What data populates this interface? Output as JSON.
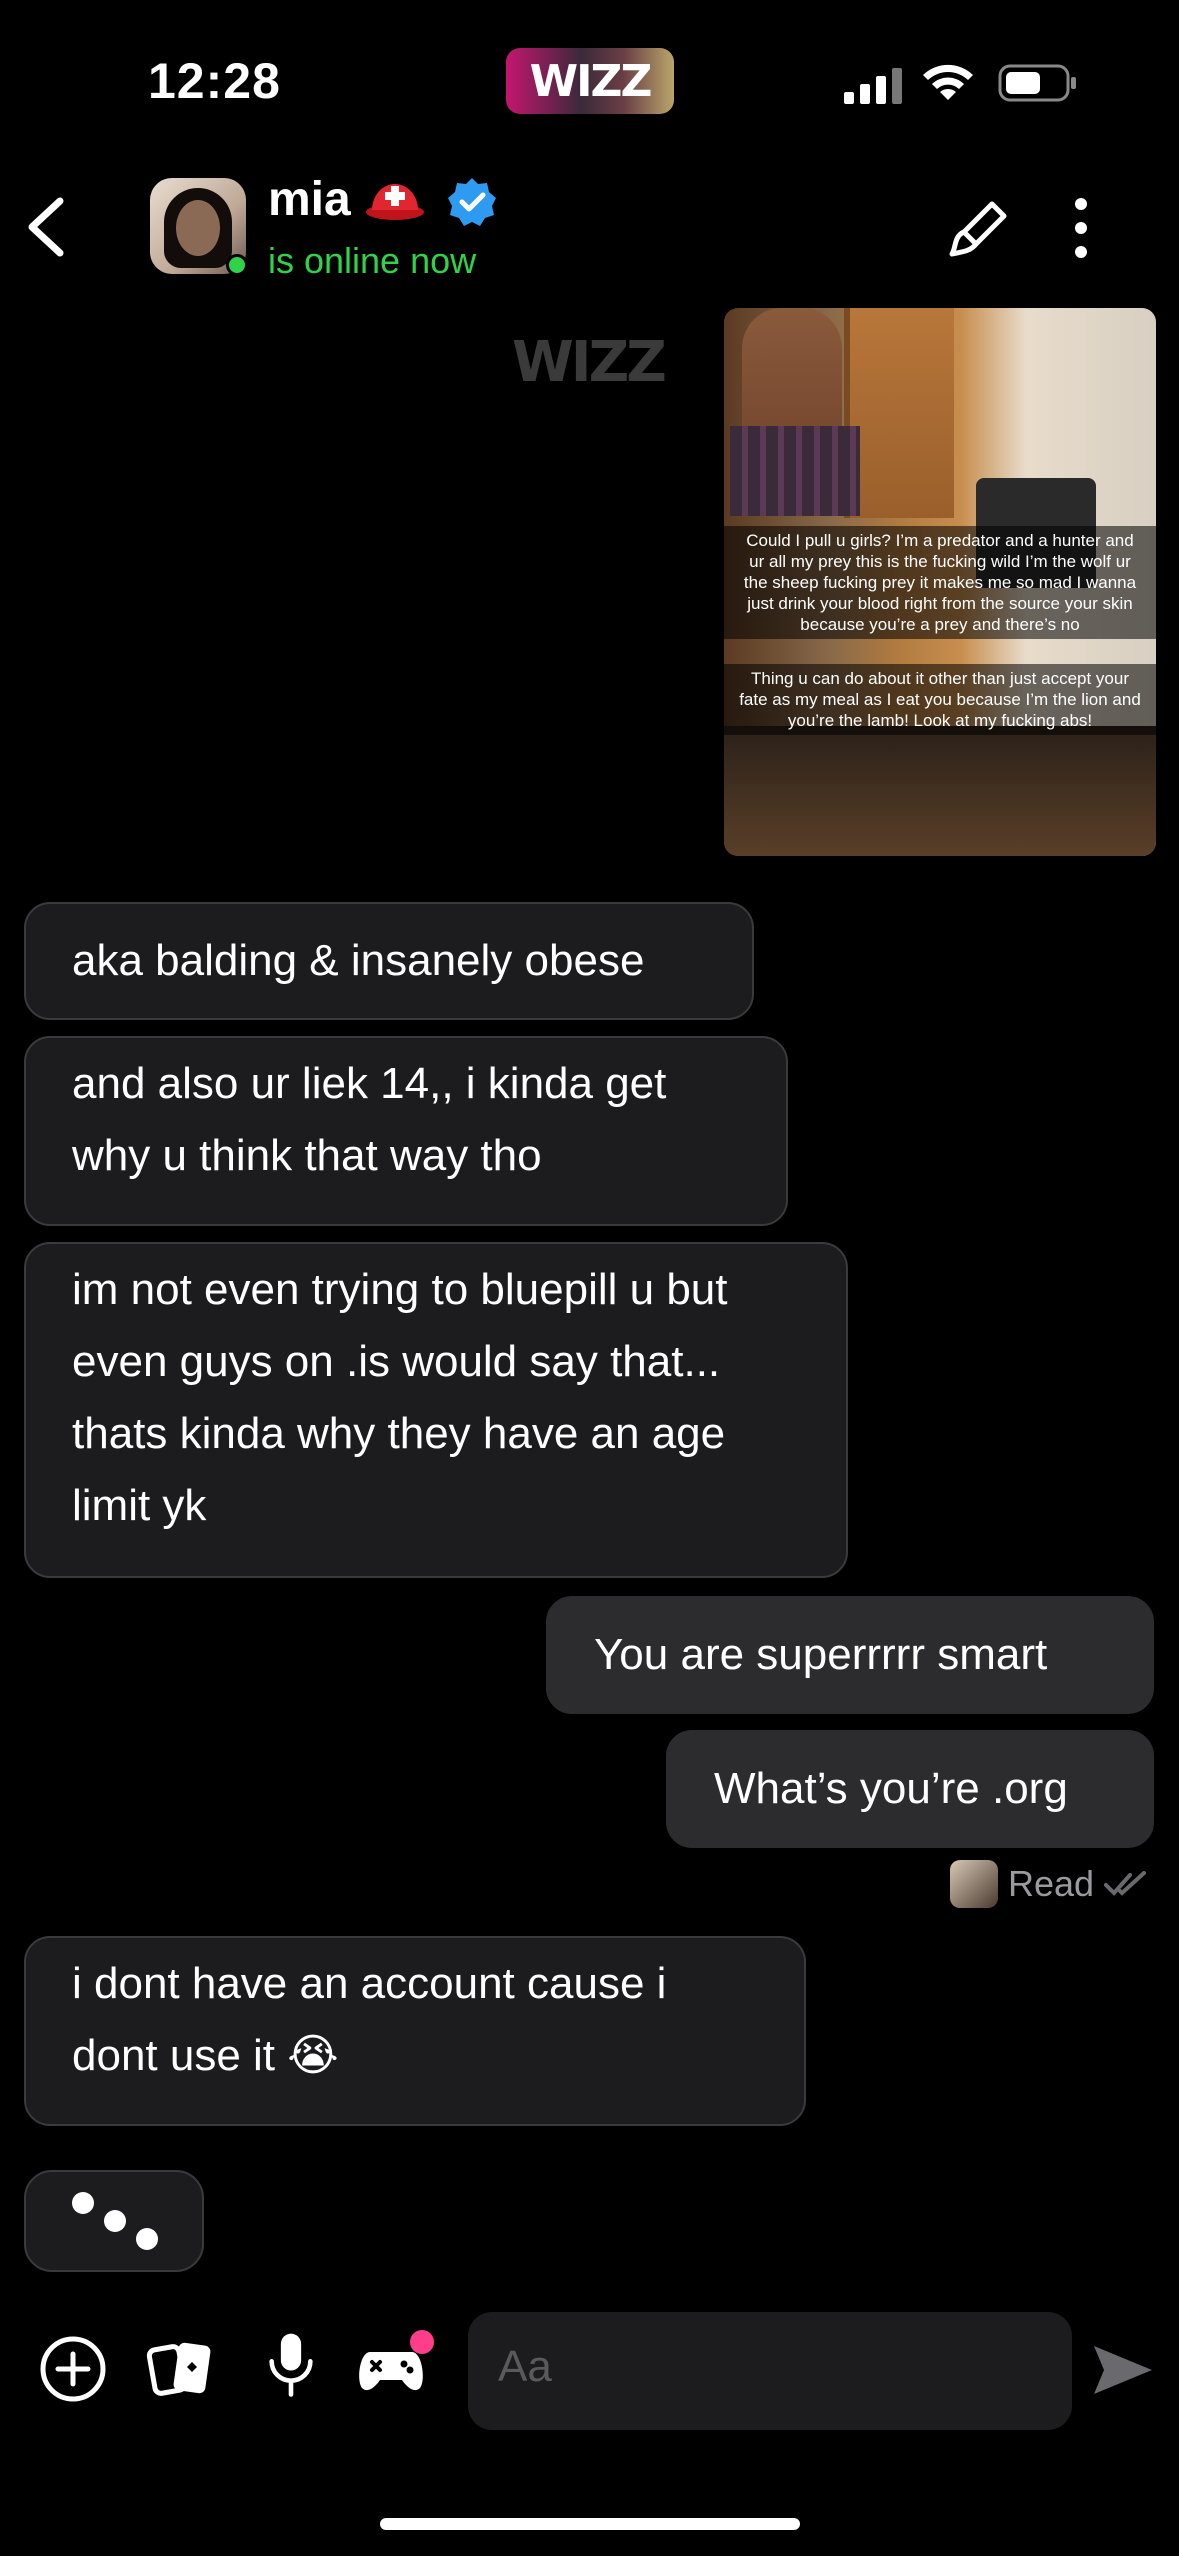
{
  "status_bar": {
    "time": "12:28",
    "app_badge": "WIZZ"
  },
  "header": {
    "contact_name": "mia",
    "status": "is online now",
    "online_color": "#2fd34a",
    "icons": [
      "back-icon",
      "red-cross-badge-icon",
      "verified-icon",
      "brush-icon",
      "more-icon"
    ]
  },
  "watermark": "WIZZ",
  "photo_message": {
    "caption_1": "Could I pull u girls? I’m a predator and a hunter and ur all my prey this is the fucking wild I’m the wolf ur the sheep fucking prey it makes me so mad I wanna just drink your blood right from the source your skin because you’re a prey and there’s no",
    "caption_2": "Thing u can do about it other than just accept your fate as my meal as I eat you because I’m the lion and you’re the lamb! Look at my fucking abs!"
  },
  "messages": [
    {
      "side": "them",
      "text": "aka balding & insanely obese"
    },
    {
      "side": "them",
      "text": "and also ur liek 14,, i kinda get why u think that way tho"
    },
    {
      "side": "them",
      "text": "im not even trying to bluepill u but even guys on .is would say that... thats kinda why they have an age limit yk"
    },
    {
      "side": "me",
      "text": "You are superrrrr smart"
    },
    {
      "side": "me",
      "text": "What’s you’re .org"
    },
    {
      "side": "them",
      "text": "i dont have an account cause i dont use it 😭"
    }
  ],
  "read_receipt": "Read",
  "composer": {
    "placeholder": "Aa",
    "accent_dot_color": "#ff3d8b"
  }
}
